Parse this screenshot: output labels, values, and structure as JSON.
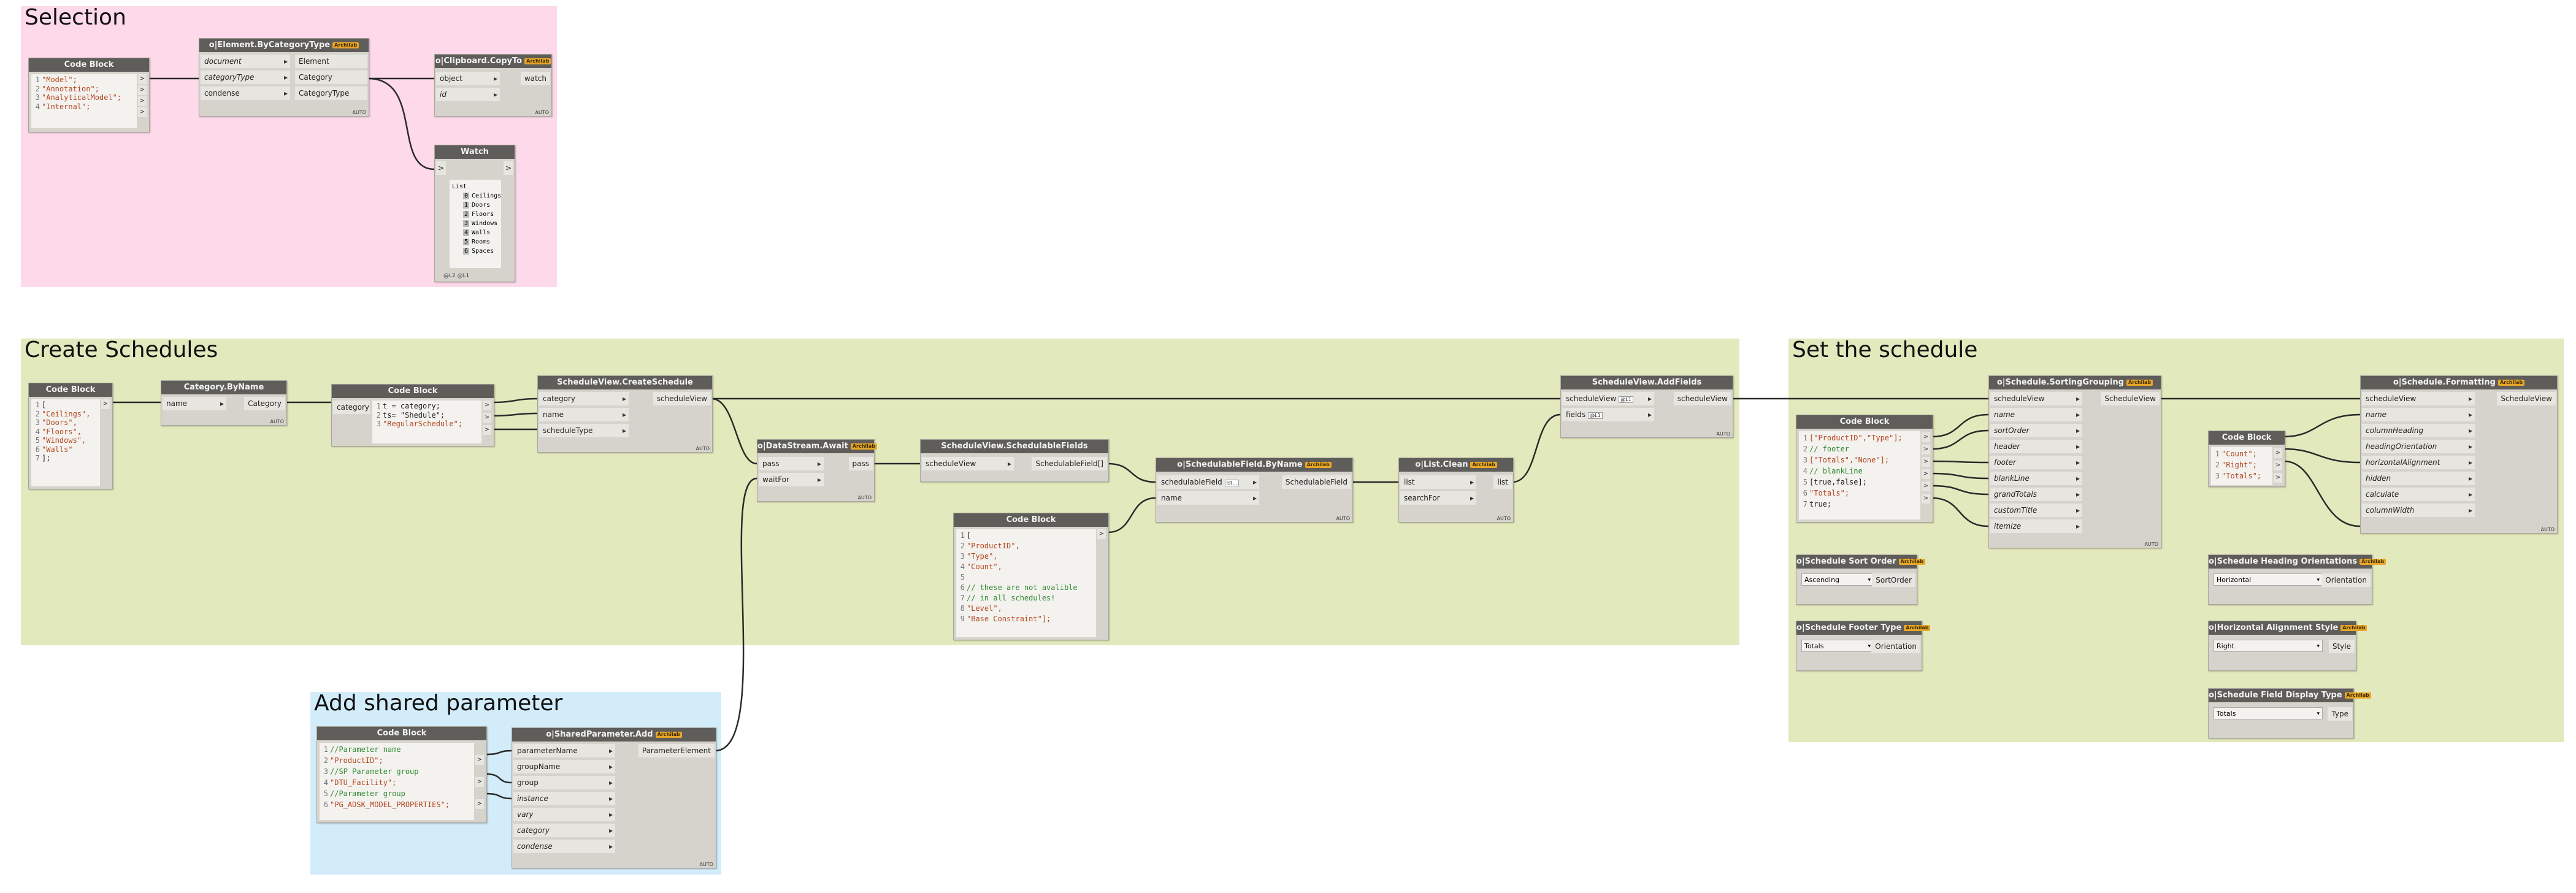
{
  "groups": {
    "selection": {
      "title": "Selection",
      "color": "#fdd9e9"
    },
    "create": {
      "title": "Create Schedules",
      "color": "#e2e9bc"
    },
    "set": {
      "title": "Set the schedule",
      "color": "#e2e9bc"
    },
    "shared": {
      "title": "Add shared parameter",
      "color": "#d2ecfa"
    }
  },
  "nodes": {
    "cb1": {
      "title": "Code Block",
      "lines": [
        [
          "1",
          "\"Model\";"
        ],
        [
          "2",
          "\"Annotation\";"
        ],
        [
          "3",
          "\"AnalyticalModel\";"
        ],
        [
          "4",
          "\"Internal\";"
        ]
      ]
    },
    "ebc": {
      "title": "o|Element.ByCategoryType",
      "badge": "Archilab",
      "inputs": [
        "document",
        "categoryType",
        "condense"
      ],
      "outputs": [
        "Element",
        "Category",
        "CategoryType"
      ],
      "auto": "AUTO"
    },
    "clip": {
      "title": "o|Clipboard.CopyTo",
      "badge": "Archilab",
      "inputs": [
        "object",
        "id"
      ],
      "outputs": [
        "watch"
      ],
      "auto": "AUTO"
    },
    "watch": {
      "title": "Watch",
      "list_label": "List",
      "items": [
        [
          "0",
          "Ceilings"
        ],
        [
          "1",
          "Doors"
        ],
        [
          "2",
          "Floors"
        ],
        [
          "3",
          "Windows"
        ],
        [
          "4",
          "Walls"
        ],
        [
          "5",
          "Rooms"
        ],
        [
          "6",
          "Spaces"
        ]
      ],
      "footer": "@L2 @L1"
    },
    "cb2": {
      "title": "Code Block",
      "lines": [
        [
          "1",
          "["
        ],
        [
          "2",
          "\"Ceilings\","
        ],
        [
          "3",
          "\"Doors\","
        ],
        [
          "4",
          "\"Floors\","
        ],
        [
          "5",
          "\"Windows\","
        ],
        [
          "6",
          "\"Walls\""
        ],
        [
          "7",
          "];"
        ]
      ]
    },
    "catbn": {
      "title": "Category.ByName",
      "inputs": [
        "name"
      ],
      "outputs": [
        "Category"
      ],
      "auto": "AUTO"
    },
    "cb3": {
      "title": "Code Block",
      "input": "category",
      "lines": [
        [
          "1",
          "t = category;"
        ],
        [
          "2",
          "ts= \"Shedule\";"
        ],
        [
          "3",
          "\"RegularSchedule\";"
        ]
      ]
    },
    "svcs": {
      "title": "ScheduleView.CreateSchedule",
      "inputs": [
        "category",
        "name",
        "scheduleType"
      ],
      "outputs": [
        "scheduleView"
      ],
      "auto": "AUTO"
    },
    "await": {
      "title": "o|DataStream.Await",
      "badge": "Archilab",
      "inputs": [
        "pass",
        "waitFor"
      ],
      "outputs": [
        "pass"
      ],
      "auto": "AUTO"
    },
    "svsf": {
      "title": "ScheduleView.SchedulableFields",
      "inputs": [
        "scheduleView"
      ],
      "outputs": [
        "SchedulableField[]"
      ]
    },
    "cb4": {
      "title": "Code Block",
      "lines": [
        [
          "1",
          "["
        ],
        [
          "2",
          "\"ProductID\","
        ],
        [
          "3",
          "\"Type\","
        ],
        [
          "4",
          "\"Count\","
        ],
        [
          "5",
          ""
        ],
        [
          "6",
          "// these are not avalible"
        ],
        [
          "7",
          "// in all schedules!"
        ],
        [
          "8",
          "\"Level\","
        ],
        [
          "9",
          "\"Base Constraint\"];"
        ]
      ]
    },
    "sfbn": {
      "title": "o|SchedulableField.ByName",
      "badge": "Archilab",
      "inputs": [
        "schedulableField",
        "name"
      ],
      "outputs": [
        "SchedulableField"
      ],
      "auto": "AUTO",
      "flag": "lst..."
    },
    "lclean": {
      "title": "o|List.Clean",
      "badge": "Archilab",
      "inputs": [
        "list",
        "searchFor"
      ],
      "outputs": [
        "list"
      ],
      "auto": "AUTO"
    },
    "svaf": {
      "title": "ScheduleView.AddFields",
      "inputs": [
        "scheduleView",
        "fields"
      ],
      "outputs": [
        "scheduleView"
      ],
      "auto": "AUTO",
      "flag": "@L1"
    },
    "cb5": {
      "title": "Code Block",
      "lines": [
        [
          "1",
          "[\"ProductID\",\"Type\"];"
        ],
        [
          "2",
          "// footer"
        ],
        [
          "3",
          "[\"Totals\",\"None\"];"
        ],
        [
          "4",
          "// blankLine"
        ],
        [
          "5",
          "[true,false];"
        ],
        [
          "6",
          "\"Totals\";"
        ],
        [
          "7",
          "true;"
        ]
      ]
    },
    "ssg": {
      "title": "o|Schedule.SortingGrouping",
      "badge": "Archilab",
      "inputs": [
        "scheduleView",
        "name",
        "sortOrder",
        "header",
        "footer",
        "blankLine",
        "grandTotals",
        "customTitle",
        "itemize"
      ],
      "outputs": [
        "ScheduleView"
      ],
      "auto": "AUTO"
    },
    "sso": {
      "title": "o|Schedule Sort Order",
      "badge": "Archilab",
      "value": "Ascending",
      "out": "SortOrder"
    },
    "sft": {
      "title": "o|Schedule Footer Type",
      "badge": "Archilab",
      "value": "Totals",
      "out": "Orientation"
    },
    "cb6": {
      "title": "Code Block",
      "lines": [
        [
          "1",
          "\"Count\";"
        ],
        [
          "2",
          "\"Right\";"
        ],
        [
          "3",
          "\"Totals\";"
        ]
      ]
    },
    "sfmt": {
      "title": "o|Schedule.Formatting",
      "badge": "Archilab",
      "inputs": [
        "scheduleView",
        "name",
        "columnHeading",
        "headingOrientation",
        "horizontalAlignment",
        "hidden",
        "calculate",
        "columnWidth"
      ],
      "outputs": [
        "ScheduleView"
      ],
      "auto": "AUTO"
    },
    "sho": {
      "title": "o|Schedule Heading Orientations",
      "badge": "Archilab",
      "value": "Horizontal",
      "out": "Orientation"
    },
    "has": {
      "title": "o|Horizontal Alignment Style",
      "badge": "Archilab",
      "value": "Right",
      "out": "Style"
    },
    "sfdt": {
      "title": "o|Schedule Field Display Type",
      "badge": "Archilab",
      "value": "Totals",
      "out": "Type"
    },
    "cb7": {
      "title": "Code Block",
      "lines": [
        [
          "1",
          "//Parameter name"
        ],
        [
          "2",
          "\"ProductID\";"
        ],
        [
          "3",
          "//SP Parameter group"
        ],
        [
          "4",
          "\"DTU_Facility\";"
        ],
        [
          "5",
          "//Parameter group"
        ],
        [
          "6",
          "\"PG_ADSK_MODEL_PROPERTIES\";"
        ]
      ]
    },
    "spadd": {
      "title": "o|SharedParameter.Add",
      "badge": "Archilab",
      "inputs": [
        "parameterName",
        "groupName",
        "group",
        "instance",
        "vary",
        "category",
        "condense"
      ],
      "outputs": [
        "ParameterElement"
      ],
      "auto": "AUTO"
    }
  }
}
